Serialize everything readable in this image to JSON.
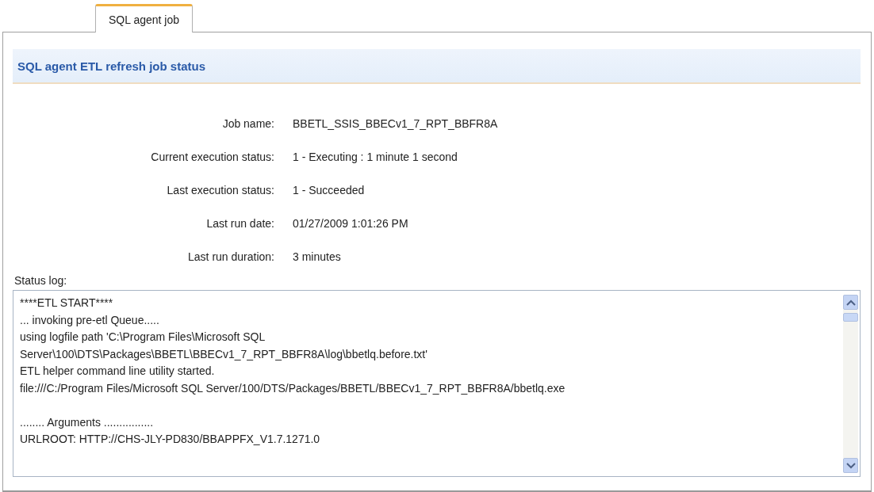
{
  "tabs": [
    {
      "label": "SQL agent job",
      "selected": true
    }
  ],
  "section_title": "SQL agent ETL refresh job status",
  "fields": [
    {
      "label": "Job name:",
      "value": "BBETL_SSIS_BBECv1_7_RPT_BBFR8A"
    },
    {
      "label": "Current execution status:",
      "value": "1 - Executing : 1 minute 1 second"
    },
    {
      "label": "Last execution status:",
      "value": "1 - Succeeded"
    },
    {
      "label": "Last run date:",
      "value": "01/27/2009 1:01:26 PM"
    },
    {
      "label": "Last run duration:",
      "value": "3 minutes"
    }
  ],
  "status_log": {
    "label": "Status log:",
    "lines": [
      {
        "text": "****ETL START****",
        "blank_before": false
      },
      {
        "text": "... invoking pre-etl Queue.....",
        "blank_before": false
      },
      {
        "text": "using logfile path 'C:\\Program Files\\Microsoft SQL",
        "blank_before": false
      },
      {
        "text": "Server\\100\\DTS\\Packages\\BBETL\\BBECv1_7_RPT_BBFR8A\\log\\bbetlq.before.txt'",
        "blank_before": false
      },
      {
        "text": "ETL helper command line utility started.",
        "blank_before": false
      },
      {
        "text": "file:///C:/Program Files/Microsoft SQL Server/100/DTS/Packages/BBETL/BBECv1_7_RPT_BBFR8A/bbetlq.exe",
        "blank_before": false
      },
      {
        "text": "........ Arguments ................",
        "blank_before": true
      },
      {
        "text": "URLROOT: HTTP://CHS-JLY-PD830/BBAPPFX_V1.7.1271.0",
        "blank_before": false
      }
    ]
  }
}
